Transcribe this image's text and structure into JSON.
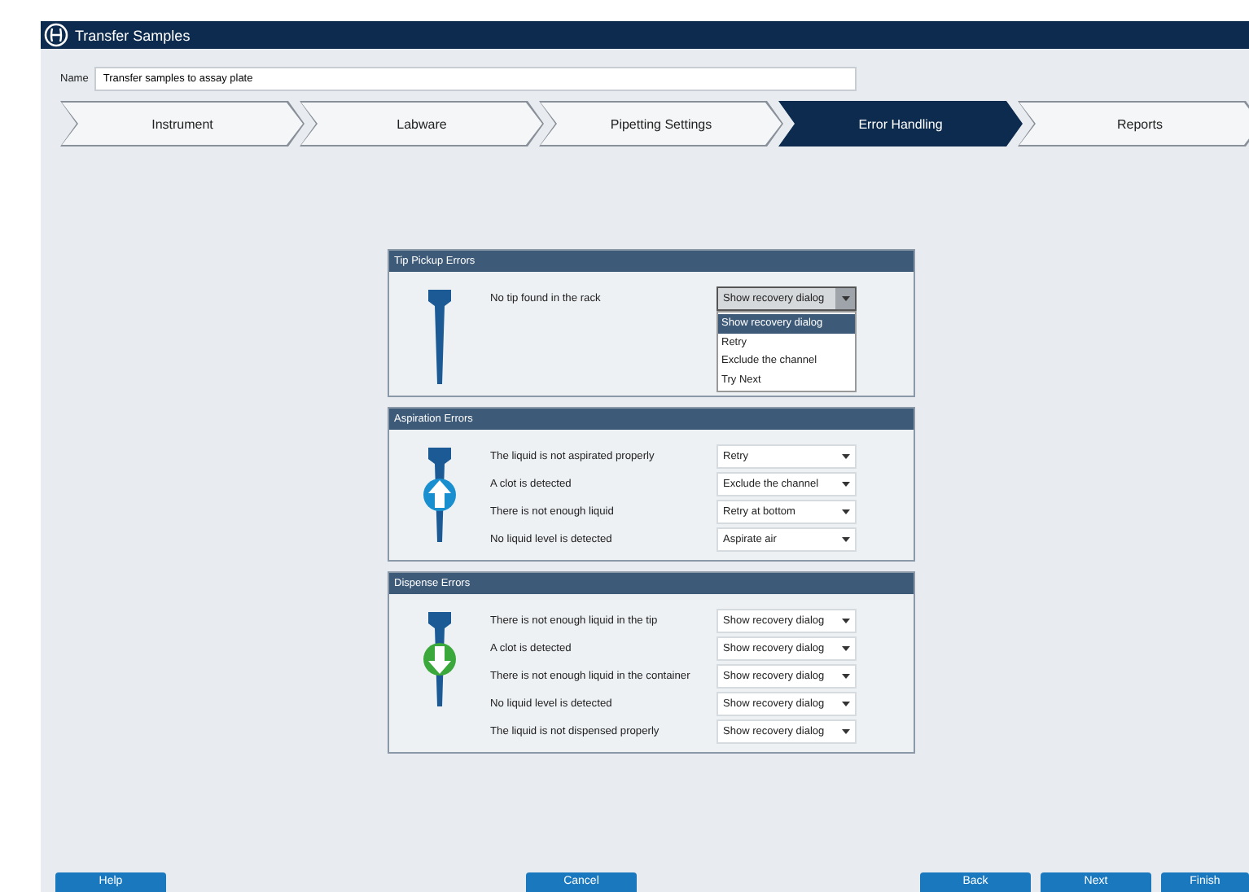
{
  "window": {
    "title": "Transfer Samples"
  },
  "name_field": {
    "label": "Name",
    "value": "Transfer samples to assay plate"
  },
  "steps": [
    {
      "label": "Instrument",
      "selected": false
    },
    {
      "label": "Labware",
      "selected": false
    },
    {
      "label": "Pipetting Settings",
      "selected": false
    },
    {
      "label": "Error Handling",
      "selected": true
    },
    {
      "label": "Reports",
      "selected": false
    }
  ],
  "panels": [
    {
      "title": "Tip Pickup Errors",
      "kind": "pickup",
      "rows": [
        {
          "label": "No tip found in the rack",
          "value": "Show recovery dialog",
          "expanded": true,
          "options": [
            {
              "label": "Show recovery dialog",
              "selected": true
            },
            {
              "label": "Retry",
              "selected": false
            },
            {
              "label": "Exclude the channel",
              "selected": false
            },
            {
              "label": "Try Next",
              "selected": false
            }
          ]
        }
      ]
    },
    {
      "title": "Aspiration Errors",
      "kind": "aspirate",
      "rows": [
        {
          "label": "The liquid is not aspirated properly",
          "value": "Retry",
          "expanded": false
        },
        {
          "label": "A clot is detected",
          "value": "Exclude the channel",
          "expanded": false
        },
        {
          "label": "There is not enough liquid",
          "value": "Retry at bottom",
          "expanded": false
        },
        {
          "label": "No liquid level is detected",
          "value": "Aspirate air",
          "expanded": false
        }
      ]
    },
    {
      "title": "Dispense Errors",
      "kind": "dispense",
      "rows": [
        {
          "label": "There is not enough liquid in the tip",
          "value": "Show recovery dialog",
          "expanded": false
        },
        {
          "label": "A clot is detected",
          "value": "Show recovery dialog",
          "expanded": false
        },
        {
          "label": "There is not enough liquid in the container",
          "value": "Show recovery dialog",
          "expanded": false
        },
        {
          "label": "No liquid level is detected",
          "value": "Show recovery dialog",
          "expanded": false
        },
        {
          "label": "The liquid is not dispensed properly",
          "value": "Show recovery dialog",
          "expanded": false
        }
      ]
    }
  ],
  "buttons": {
    "left": [
      "Help"
    ],
    "center": [
      "Cancel"
    ],
    "right": [
      "Back",
      "Next",
      "Finish"
    ]
  }
}
